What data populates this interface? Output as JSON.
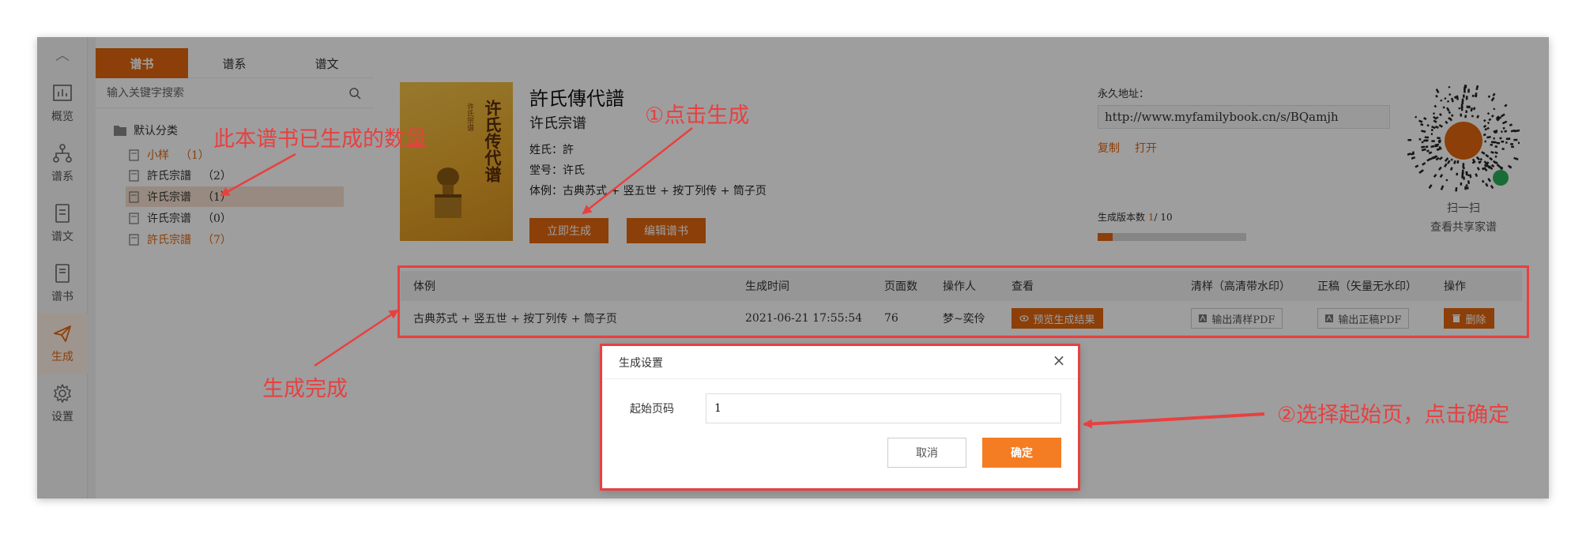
{
  "nav": {
    "collapse_icon": "chevron-up-icon",
    "items": [
      {
        "label": "概览",
        "icon": "chart-icon",
        "active": false
      },
      {
        "label": "谱系",
        "icon": "tree-icon",
        "active": false
      },
      {
        "label": "谱文",
        "icon": "doc-icon",
        "active": false
      },
      {
        "label": "谱书",
        "icon": "book-icon",
        "active": false
      },
      {
        "label": "生成",
        "icon": "send-icon",
        "active": true
      },
      {
        "label": "设置",
        "icon": "gear-icon",
        "active": false
      }
    ]
  },
  "tree": {
    "tabs": [
      {
        "label": "谱书",
        "active": true
      },
      {
        "label": "谱系",
        "active": false
      },
      {
        "label": "谱文",
        "active": false
      }
    ],
    "search_placeholder": "输入关键字搜索",
    "category": "默认分类",
    "books": [
      {
        "name": "小样",
        "count": "（1）",
        "style": "orange"
      },
      {
        "name": "許氏宗譜",
        "count": "（2）",
        "style": "normal"
      },
      {
        "name": "许氏宗谱",
        "count": "（1）",
        "style": "selected"
      },
      {
        "name": "许氏宗谱",
        "count": "（0）",
        "style": "normal"
      },
      {
        "name": "許氏宗譜",
        "count": "（7）",
        "style": "orange"
      }
    ]
  },
  "book": {
    "cover_title": "许氏传代谱",
    "cover_sub": "许氏宗谱",
    "title": "許氏傳代譜",
    "subtitle": "许氏宗谱",
    "surname": "姓氏：許",
    "hall": "堂号：许氏",
    "style": "体例：古典苏式 + 竖五世 + 按丁列传 + 筒子页",
    "generate_btn": "立即生成",
    "edit_btn": "编辑谱书"
  },
  "share": {
    "permanent_label": "永久地址：",
    "url": "http://www.myfamilybook.cn/s/BQamjh",
    "copy": "复制",
    "open": "打开",
    "version_label": "生成版本数",
    "version_used": "1",
    "version_total": "/ 10",
    "progress": 0.1,
    "qr_line1": "扫一扫",
    "qr_line2": "查看共享家谱"
  },
  "table": {
    "headers": [
      "体例",
      "生成时间",
      "页面数",
      "操作人",
      "查看",
      "清样（高清带水印）",
      "正稿（矢量无水印）",
      "操作"
    ],
    "rows": [
      {
        "style": "古典苏式 + 竖五世 + 按丁列传 + 筒子页",
        "time": "2021-06-21 17:55:54",
        "pages": "76",
        "operator": "梦~奕伶",
        "preview": "预览生成结果",
        "draft_pdf": "输出清样PDF",
        "final_pdf": "输出正稿PDF",
        "delete": "删除"
      }
    ]
  },
  "dialog": {
    "title": "生成设置",
    "label": "起始页码",
    "value": "1",
    "cancel": "取消",
    "ok": "确定"
  },
  "annotations": {
    "count_note": "此本谱书已生成的数量",
    "step1": "①点击生成",
    "done": "生成完成",
    "step2": "②选择起始页，点击确定"
  },
  "colors": {
    "accent": "#e2660e",
    "annotation": "#e84040",
    "ok_button": "#f47c22"
  }
}
